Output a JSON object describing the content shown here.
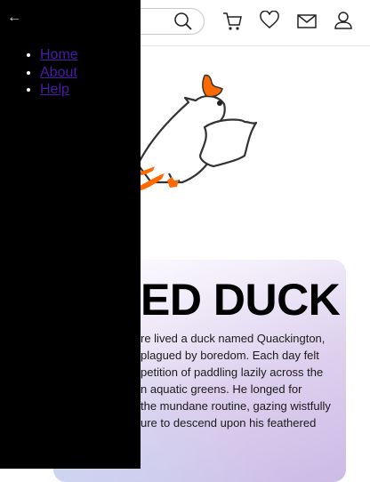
{
  "drawer": {
    "back_icon": "arrow-left-icon",
    "nav": [
      {
        "label": "Home"
      },
      {
        "label": "About"
      },
      {
        "label": "Help"
      }
    ]
  },
  "header": {
    "icons": [
      "search-icon",
      "cart-icon",
      "heart-icon",
      "mail-icon",
      "user-icon"
    ]
  },
  "hero": {
    "title": "ED DUCK",
    "lines": [
      "re lived a duck named Quackington,",
      "plagued by boredom. Each day felt",
      "petition of paddling lazily across the",
      "n aquatic greens. He longed for",
      "the mundane routine, gazing wistfully",
      "ure to descend upon his feathered"
    ]
  },
  "colors": {
    "accent": "#ff6a00",
    "link": "#4a1aa8",
    "drawer": "#000000"
  }
}
